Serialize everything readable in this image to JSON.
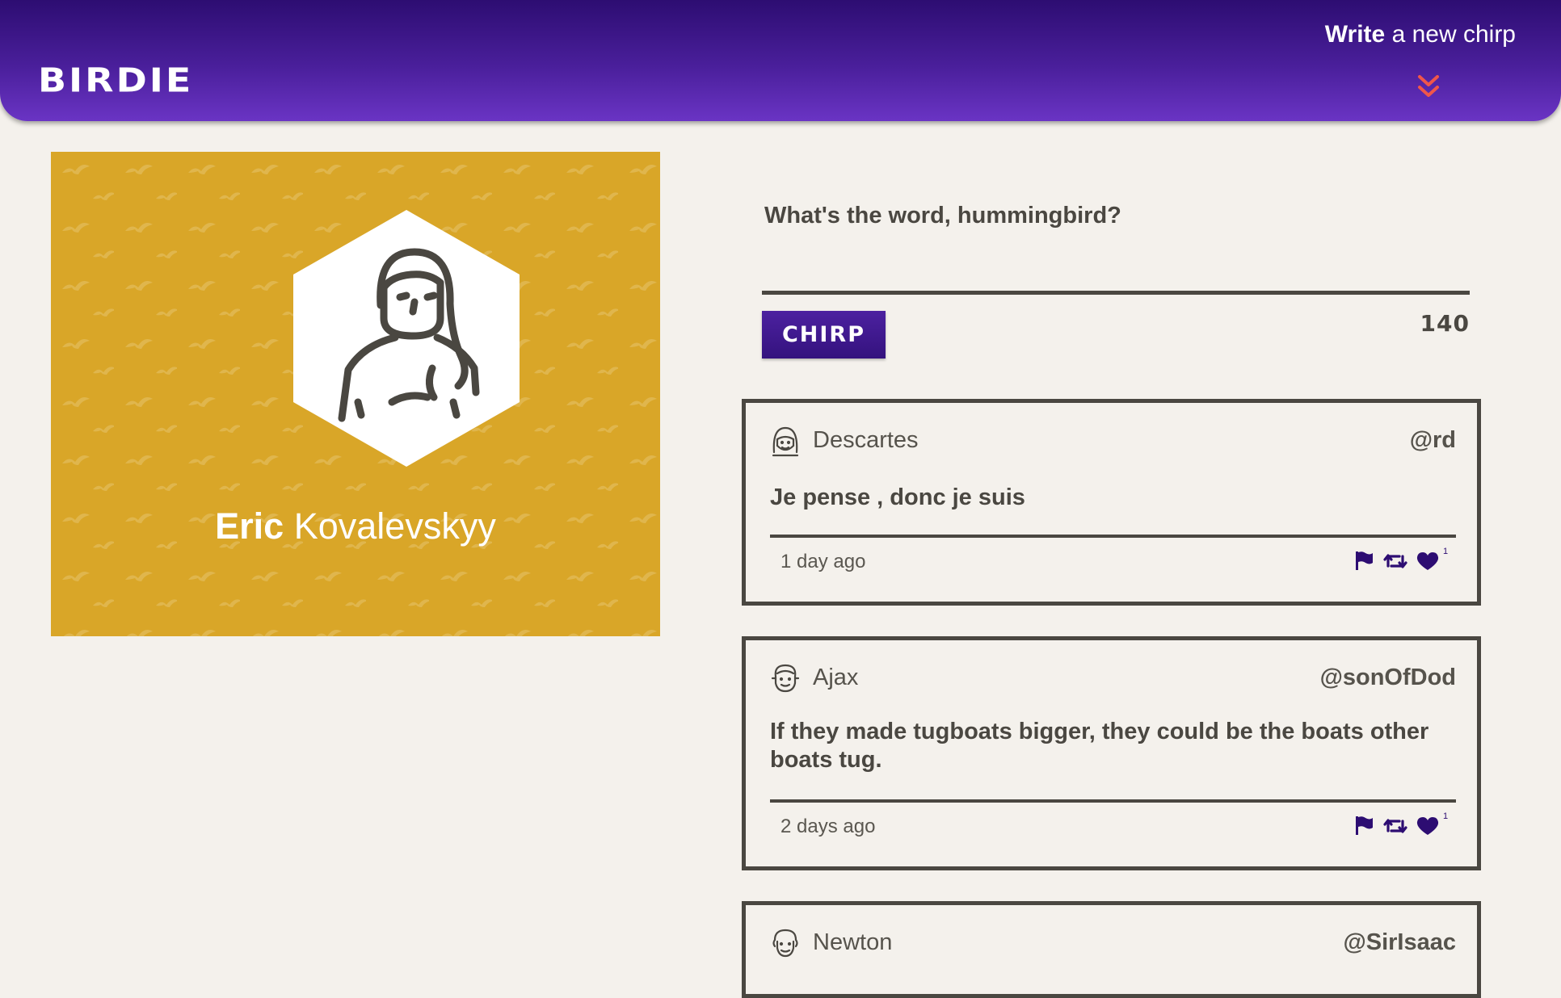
{
  "header": {
    "logo": "BIRDIE",
    "write_bold": "Write",
    "write_rest": "a new chirp",
    "chevron_icon": "double-chevron-down-icon",
    "chevron_color": "#f0564a"
  },
  "profile": {
    "first_name": "Eric",
    "last_name": "Kovalevskyy",
    "background_color": "#d9a628",
    "avatar_icon": "woman-avatar-icon"
  },
  "compose": {
    "placeholder": "What's the word, hummingbird?",
    "button_label": "CHIRP",
    "char_count": "140"
  },
  "chirps": [
    {
      "author": "Descartes",
      "handle": "@rd",
      "text": "Je pense , donc je suis",
      "time": "1 day ago",
      "likes": "1",
      "avatar_icon": "woman-face-icon"
    },
    {
      "author": "Ajax",
      "handle": "@sonOfDod",
      "text": "If they made tugboats bigger, they could be the boats other boats tug.",
      "time": "2 days ago",
      "likes": "1",
      "avatar_icon": "man-face-icon"
    },
    {
      "author": "Newton",
      "handle": "@SirIsaac",
      "avatar_icon": "curly-hair-face-icon"
    }
  ],
  "icons": {
    "flag": "flag-icon",
    "retweet": "rechirp-icon",
    "like": "heart-icon",
    "accent": "#2d0d72"
  }
}
